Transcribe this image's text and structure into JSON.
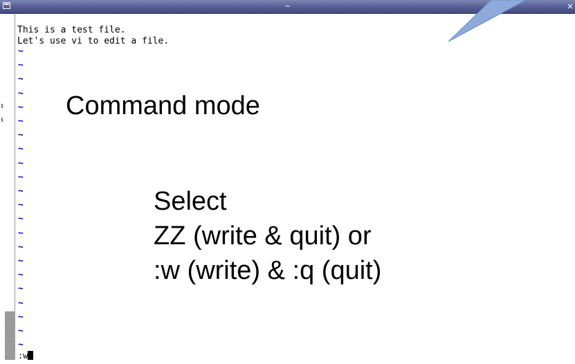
{
  "window": {
    "title": "~",
    "close_glyph": "×"
  },
  "buffer": {
    "lines": [
      "This is a test file.",
      "Let's use vi to edit a file."
    ],
    "tilde_glyph": "~",
    "tilde_count": 22
  },
  "command_line": {
    "text": ":w"
  },
  "annotation": {
    "heading": "Command mode",
    "lines": [
      "Select",
      "ZZ (write & quit) or",
      ":w (write)  & :q (quit)"
    ]
  },
  "colors": {
    "titlebar": "#555d94",
    "tilde": "#0000c8",
    "callout_fill": "#8eaadb",
    "callout_stroke": "#6f8fc8"
  }
}
